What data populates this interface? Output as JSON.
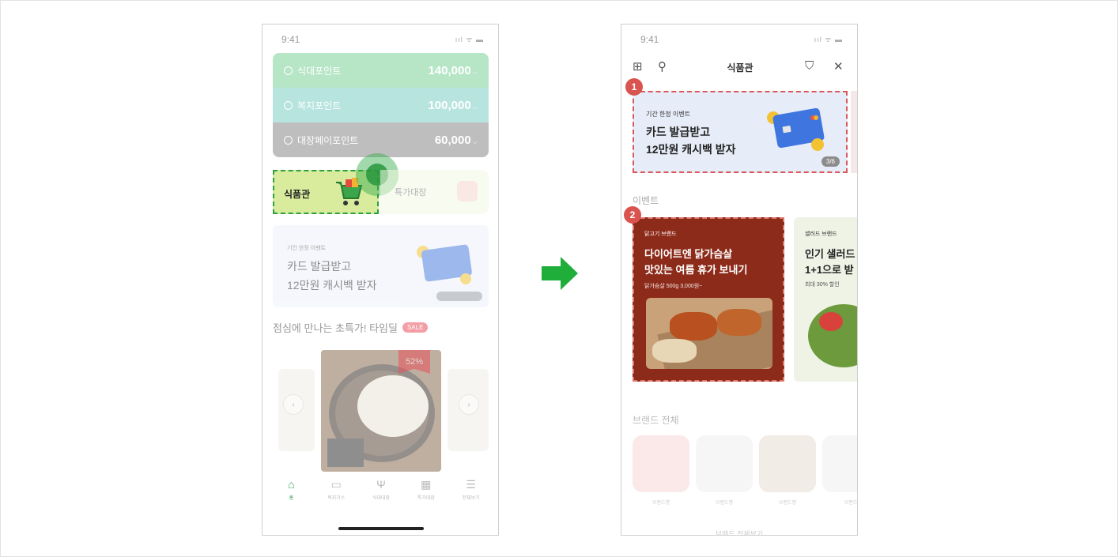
{
  "left_phone": {
    "status": {
      "time": "9:41",
      "icons": "ııl ᯤ ▬"
    },
    "points": [
      {
        "label": "식대포인트",
        "value": "140,000"
      },
      {
        "label": "복지포인트",
        "value": "100,000"
      },
      {
        "label": "대장페이포인트",
        "value": "60,000"
      }
    ],
    "shop_tile": {
      "label": "식품관"
    },
    "deal_tile": {
      "label": "특가대장"
    },
    "banner": {
      "tag": "기간 한정 이벤트",
      "line1": "카드 발급받고",
      "line2": "12만원 캐시백 받자"
    },
    "section": {
      "title": "점심에 만나는 초특가! 타임딜",
      "badge": "SALE"
    },
    "product": {
      "discount": "52%"
    },
    "arrows": {
      "prev": "‹",
      "next": "›"
    },
    "tabbar": [
      {
        "icon": "⌂",
        "label": "홈"
      },
      {
        "icon": "▭",
        "label": "복지가스"
      },
      {
        "icon": "Ψ",
        "label": "식대대장"
      },
      {
        "icon": "▦",
        "label": "특가대장"
      },
      {
        "icon": "☰",
        "label": "전체보기"
      }
    ]
  },
  "right_phone": {
    "status": {
      "time": "9:41",
      "icons": "ııl ᯤ ▬"
    },
    "topbar": {
      "grid": "⊞",
      "search": "⚲",
      "title": "식품관",
      "cart": "⛉",
      "close": "✕"
    },
    "callouts": [
      "1",
      "2"
    ],
    "banner": {
      "tag": "기간 한정 이벤트",
      "line1": "카드 발급받고",
      "line2": "12만원 캐시백 받자",
      "pager": "3/6"
    },
    "events_title": "이벤트",
    "events": [
      {
        "tag": "닭고기 브랜드",
        "line1": "다이어트엔 닭가슴살",
        "line2": "맛있는 여름 휴가 보내기",
        "sub": "닭가슴살 500g 3,000원~"
      },
      {
        "tag": "샐러드 브랜드",
        "line1": "인기 샐러드",
        "line2": "1+1으로 받",
        "sub": "최대 30% 할인"
      }
    ],
    "brands_title": "브랜드 전체",
    "brands": [
      "브랜드명",
      "브랜드명",
      "브랜드명",
      "브랜드"
    ],
    "brand_colors": [
      "#fbe9e9",
      "#f6f6f6",
      "#f1ece6",
      "#f6f6f6"
    ],
    "brands_more": "브랜드 전체보기"
  },
  "colors": {
    "accent_green": "#2e9e3e",
    "callout_red": "#d9534f",
    "arrow_green": "#1fae3a"
  }
}
